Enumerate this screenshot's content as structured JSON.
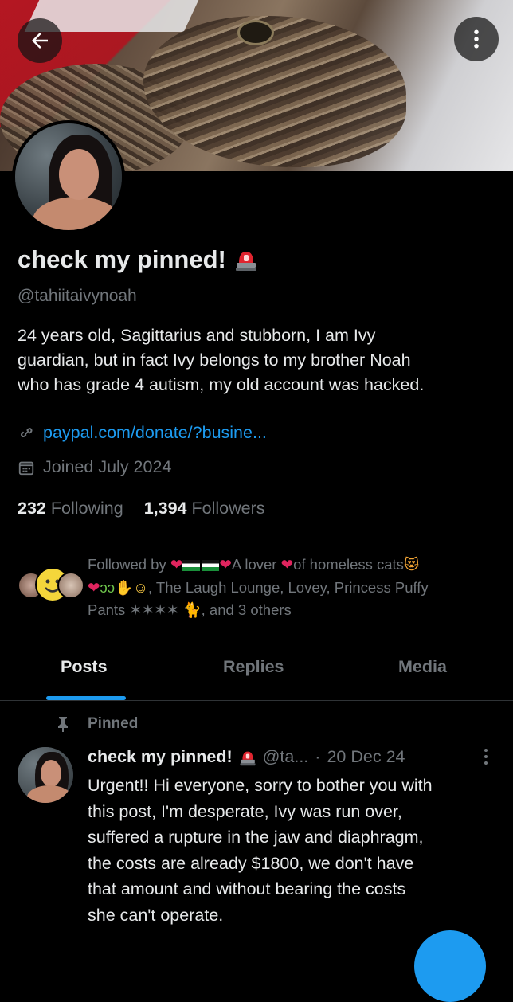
{
  "header": {
    "back_icon": "arrow-left-icon",
    "more_icon": "more-vertical-icon"
  },
  "profile": {
    "display_name": "check my pinned!",
    "name_emoji": "police-light-emoji",
    "handle": "@tahiitaivynoah",
    "bio_lines": [
      "24 years old, Sagittarius and stubborn, I am Ivy",
      "guardian, but in fact Ivy belongs to my brother Noah",
      "who has grade 4 autism, my old account was hacked."
    ],
    "link": "paypal.com/donate/?busine...",
    "joined": "Joined July 2024",
    "following_count": "232",
    "following_label": "Following",
    "followers_count": "1,394",
    "followers_label": "Followers"
  },
  "followed_by": {
    "line1_prefix": "Followed by ",
    "line1_text": "A lover ",
    "line1_text2": "of homeless cats",
    "line2_text": ", The Laugh Lounge, Lovey, Princess Puffy",
    "line3_text": "Pants ✶✶✶✶ ",
    "line3_suffix": ", and 3 others"
  },
  "tabs": [
    {
      "label": "Posts",
      "active": true
    },
    {
      "label": "Replies",
      "active": false
    },
    {
      "label": "Media",
      "active": false
    }
  ],
  "pinned_post": {
    "pinned_label": "Pinned",
    "author_name": "check my pinned!",
    "author_handle": "@ta...",
    "dot": "·",
    "date": "20 Dec 24",
    "body_lines": [
      "Urgent!! Hi everyone, sorry to bother you with",
      "this post, I'm desperate, Ivy was run over,",
      "suffered a rupture in the jaw and diaphragm,",
      "the costs are already $1800, we don't have",
      "that amount and without bearing the costs",
      "she can't operate."
    ]
  },
  "colors": {
    "background": "#000000",
    "text": "#e7e9ea",
    "muted": "#71767b",
    "accent": "#1d9bf0",
    "divider": "#2f3336"
  }
}
